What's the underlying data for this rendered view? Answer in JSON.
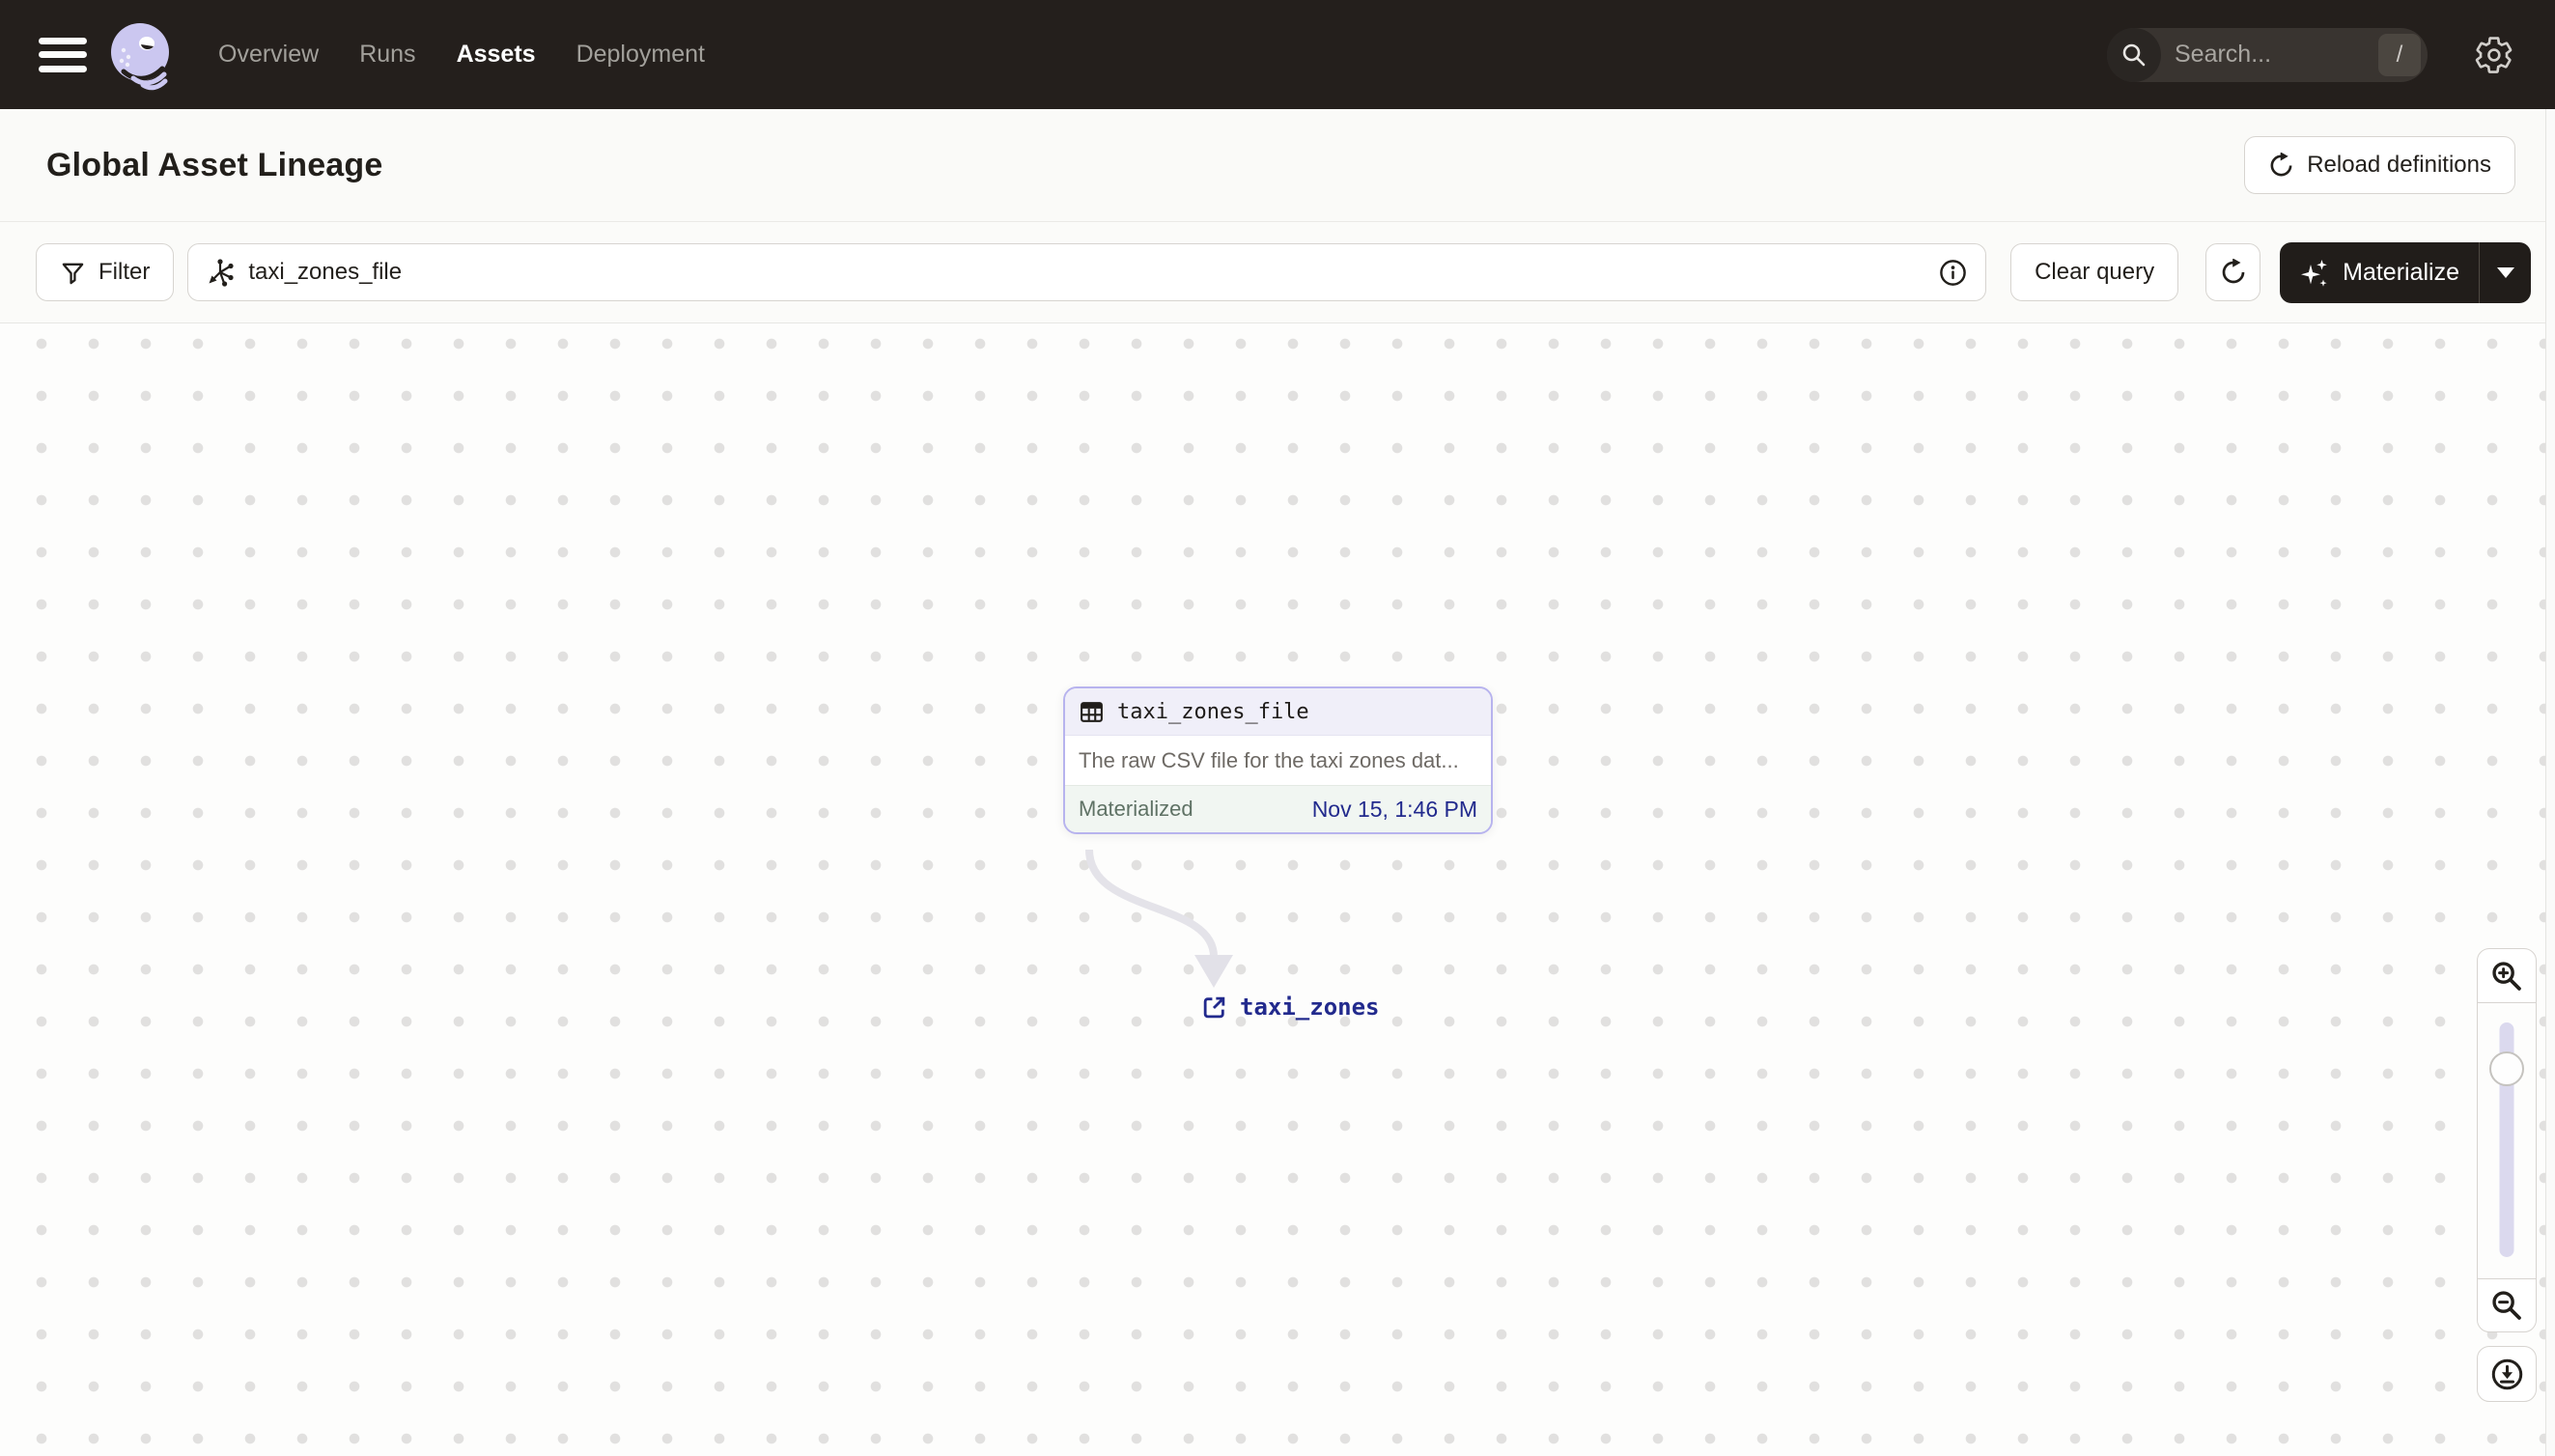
{
  "nav": {
    "items": [
      {
        "label": "Overview",
        "active": false
      },
      {
        "label": "Runs",
        "active": false
      },
      {
        "label": "Assets",
        "active": true
      },
      {
        "label": "Deployment",
        "active": false
      }
    ],
    "search": {
      "placeholder": "Search...",
      "shortcut": "/"
    }
  },
  "header": {
    "title": "Global Asset Lineage",
    "reload_button_label": "Reload definitions"
  },
  "toolbar": {
    "filter_button_label": "Filter",
    "query_value": "taxi_zones_file",
    "clear_query_label": "Clear query",
    "materialize_label": "Materialize"
  },
  "graph": {
    "asset_node": {
      "name": "taxi_zones_file",
      "description": "The raw CSV file for the taxi zones dat...",
      "status_label": "Materialized",
      "status_timestamp": "Nov 15, 1:46 PM"
    },
    "downstream_asset": {
      "name": "taxi_zones"
    }
  },
  "icons": {
    "hamburger-icon": "three horizontal bars",
    "dagster-logo": "lavender octopus mark",
    "search-icon": "magnifier",
    "gear-icon": "settings gear",
    "reload-icon": "clockwise circular arrow",
    "filter-icon": "funnel",
    "asset-graph-icon": "op graph star glyph",
    "info-icon": "circled i",
    "refresh-icon": "clockwise circular arrow",
    "sparkles-icon": "four-point stars",
    "caret-down-icon": "filled down triangle",
    "table-icon": "grid table",
    "external-link-icon": "box with north-east arrow",
    "zoom-in-icon": "magnifier with plus",
    "zoom-out-icon": "magnifier with minus",
    "recenter-icon": "circled arrow onto line"
  },
  "colors": {
    "nav_bg": "#241F1C",
    "dark_button_bg": "#211D1A",
    "accent_lavender_border": "#B7B3EE",
    "node_header_bg": "#F0EFF9",
    "materialized_footer_bg": "#F1F6F2",
    "materialized_text": "#5F7265",
    "timestamp_navy": "#222A8D",
    "edge_gray": "#E4E3E9",
    "dot_grid": "#E1E0DF"
  }
}
